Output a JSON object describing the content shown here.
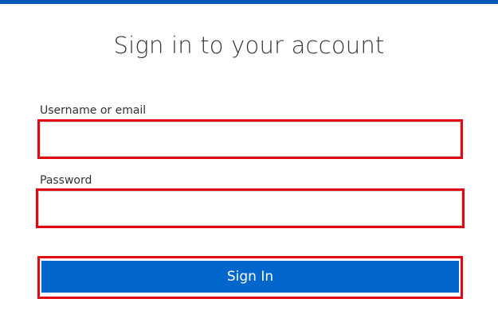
{
  "header": {
    "accent_color": "#0358b8"
  },
  "login": {
    "title": "Sign in to your account",
    "username_label": "Username or email",
    "username_value": "",
    "password_label": "Password",
    "password_value": "",
    "submit_label": "Sign In",
    "button_color": "#0066cc",
    "highlight_color": "#e30613"
  }
}
